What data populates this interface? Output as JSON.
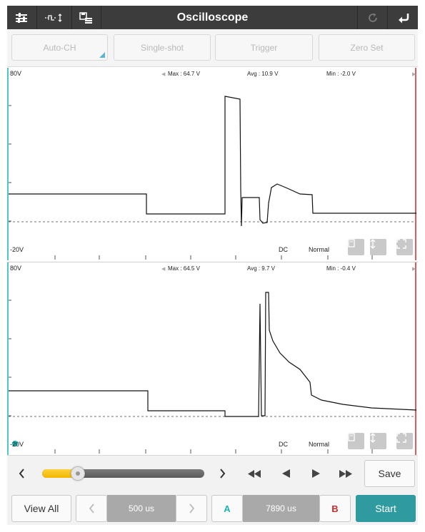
{
  "app": {
    "title": "Oscilloscope"
  },
  "toolbar": {
    "buttons": [
      {
        "label": "Auto-CH"
      },
      {
        "label": "Single-shot"
      },
      {
        "label": "Trigger"
      },
      {
        "label": "Zero Set"
      }
    ]
  },
  "channels": [
    {
      "scale_top": "80V",
      "scale_bottom": "-20V",
      "max": "Max : 64.7 V",
      "avg": "Avg : 10.9 V",
      "min": "Min : -2.0 V",
      "coupling": "DC",
      "mode": "Normal"
    },
    {
      "scale_top": "80V",
      "scale_bottom": "-20V",
      "max": "Max : 64.5 V",
      "avg": "Avg : 9.7 V",
      "min": "Min : -0.4 V",
      "coupling": "DC",
      "mode": "Normal"
    }
  ],
  "controls": {
    "position": 0.22,
    "save_label": "Save"
  },
  "bottom": {
    "view_all_label": "View All",
    "timebase": "500 us",
    "cursor_a_label": "A",
    "cursor_delta": "7890 us",
    "cursor_b_label": "B",
    "start_label": "Start"
  },
  "colors": {
    "title_bar": "#3c3c3c",
    "cursor_a": "#19b3b3",
    "cursor_b": "#cc2a2a",
    "start_button": "#2f9aa0",
    "slider_fill": "#f5bd08"
  },
  "icons": {
    "settings": "sliders-icon",
    "measure": "waveform-measure-icon",
    "save_file": "save-list-icon",
    "refresh": "refresh-icon",
    "back": "back-arrow-icon"
  }
}
